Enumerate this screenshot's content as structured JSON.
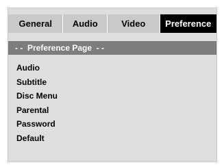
{
  "tabs": [
    {
      "label": "General",
      "active": false
    },
    {
      "label": "Audio",
      "active": false
    },
    {
      "label": "Video",
      "active": false
    },
    {
      "label": "Preference",
      "active": true
    }
  ],
  "page_header": "- -  Preference Page  - -",
  "menu_items": [
    "Audio",
    "Subtitle",
    "Disc Menu",
    "Parental",
    "Password",
    "Default"
  ],
  "colors": {
    "screen_background": "#dedede",
    "tab_background": "#c9c9c9",
    "active_tab_background": "#000000",
    "header_background": "#7d7d7d"
  }
}
